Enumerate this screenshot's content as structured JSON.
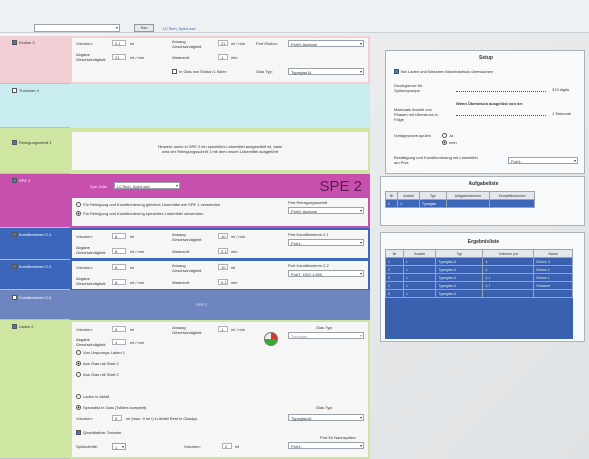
{
  "toolbar": {
    "method_select": "",
    "save_label": "Sav",
    "file_name": "LCTech_Spe4.xsd"
  },
  "left": {
    "elution": "Elution 3",
    "trocknen": "Trocknen 4",
    "reinigung": "Reinigungsventil 1",
    "spe": "SPE 2",
    "kond21": "Konditionieren 2.1",
    "kond22": "Konditionieren 2.2",
    "kond23": "Konditionieren 2.3",
    "laden": "Laden 2"
  },
  "elution_block": {
    "volumen_label": "Volumen:",
    "volumen_value": "0.1",
    "volumen_unit": "ml",
    "ansaug_label": "Ansaug Geschwindigkeit:",
    "ansaug_value": "21",
    "ansaug_unit": "ml / min",
    "port_label": "Port Elution:",
    "port_value": "Port9: Acetone",
    "abgabe_label": "Abgabe Geschwindigkeit:",
    "abgabe_value": "21",
    "abgabe_unit": "ml / min",
    "wartezeit_label": "Wartezeit:",
    "wartezeit_value": "1",
    "wartezeit_unit": "min",
    "glas_check": "In Glas von Elution 1 füllen",
    "glas_typ_label": "Glas Typ:",
    "glas_typ_value": "Typeglas14"
  },
  "reinigung_block": {
    "hint_line1": "Hinweis: wenn in SPE 2 ein spezielles Lösemittel ausgewählt ist, dann",
    "hint_line2": "wird der Reinigungsschritt 1 mit dem neuen Lösemittel ausgeführt"
  },
  "spe_block": {
    "spe_file_label": "Spe-Zelle",
    "spe_file_value": "LCTech_Spe4.xsd",
    "title": "SPE 2",
    "radio1": "Für Reinigung und Konditionierung gleiches Lösemittel wie SPE 1 verwenden",
    "radio2": "Für Reinigung und Konditionierung spezielles Lösemittel verwenden",
    "port_reinigung_label": "Port Reinigungsschritt",
    "port_reinigung_value": "Port9: Acetone"
  },
  "kond21_block": {
    "volumen_label": "Volumen:",
    "volumen_value": "8",
    "volumen_unit": "ml",
    "ansaug_label": "Ansaug Geschwindigkeit:",
    "ansaug_value": "10",
    "ansaug_unit": "ml / min",
    "port_label": "Port Konditionieren 2.1",
    "port_value": "Port1:",
    "abgabe_label": "Abgabe Geschwindigkeit:",
    "abgabe_value": "8",
    "abgabe_unit": "ml / min",
    "wartezeit_label": "Wartezeit:",
    "wartezeit_value": "0.1",
    "wartezeit_unit": "min"
  },
  "kond22_block": {
    "volumen_label": "Volumen:",
    "volumen_value": "8",
    "volumen_unit": "ml",
    "ansaug_label": "Ansaug Geschwindigkeit:",
    "ansaug_value": "10",
    "ansaug_unit": "ml",
    "port_label": "Port Konditionieren 2.2",
    "port_value": "Port7: H2O 1:500",
    "abgabe_label": "Abgabe Geschwindigkeit:",
    "abgabe_value": "8",
    "abgabe_unit": "ml / min",
    "wartezeit_label": "Wartezeit:",
    "wartezeit_value": "0.1",
    "wartezeit_unit": "min"
  },
  "kond23_block": {
    "center_label": "SPE 2"
  },
  "laden_block": {
    "volumen_label": "Volumen:",
    "volumen_value": "5",
    "volumen_unit": "ml",
    "ansaug_label": "Ansaug Geschwindigkeit:",
    "ansaug_value": "1",
    "ansaug_unit": "ml / min",
    "glas_typ_label": "Glas Typ:",
    "glas_typ_value": "Typeglas",
    "abgabe_label": "Abgabe Geschwindigkeit:",
    "abgabe_value": "1",
    "abgabe_unit": "ml / min",
    "opt1": "Von Ursprungs Laden 1",
    "opt2": "Aus Glas mit Start 2",
    "opt3": "Aus Glas mit Start 2",
    "laden_abfall": "Laden in Abfall",
    "spuelen_check": "Spezialist in Glas (Tolldes komplett)",
    "glas_typ2_label": "Glas Typ:",
    "vol_label": "Volumen:",
    "vol_value": "5",
    "vol_rest": "ml (max. 9 ml !)   in Abfall   Rest in Glastyp:",
    "glas_typ2_value": "Typeglas16",
    "quant_check": "Quantitativer Transfer",
    "spuel_label": "Spülschritte:",
    "spuel_value": "1",
    "vol2_label": "Volumen:",
    "vol2_value": "2",
    "vol2_unit": "ml",
    "port_nach_label": "Port für Nachspülen:",
    "port_nach_value": "Port1:"
  },
  "setup": {
    "title": "Setup",
    "check1": "Bei Laden und Waschen Maximaldruck überwachen",
    "druck_label": "Druckgrenze für Spülumpumpe",
    "druck_value": "319 digits",
    "anzahl_label": "Maximale Anzahl von Phasen mit Überdruck in Folge",
    "anzahl_hint": "Wenn Überdruck ausgelöst von de:",
    "anzahl_value": "1 Sekunde",
    "vorlage_label": "Vorlageprobe-spülen",
    "vorlage_opt1": "Ja",
    "vorlage_opt2": "nein",
    "bestaetigung_label": "Bestätigung und Konditionierung mit Lösemittel am Port:",
    "bestaetigung_value": "Port1:"
  },
  "aufgaben": {
    "title": "Aufgabeliste",
    "columns": [
      "Nr",
      "Anzahl",
      "Typ",
      "Aufgabevolumen",
      "Komplettvolumen"
    ],
    "rows": [
      [
        "1",
        "1",
        "Typeglas",
        "",
        ""
      ]
    ]
  },
  "ergebnisse": {
    "title": "Ergebnisliste",
    "columns": [
      "Nr",
      "Anzahl",
      "Typ",
      "Volumen pro",
      "Name"
    ],
    "rows": [
      [
        "1",
        "1",
        "Typeglas14",
        "4",
        "Elution 3"
      ],
      [
        "2",
        "1",
        "Typeglas14",
        "4",
        "Elution 2"
      ],
      [
        "3",
        "1",
        "Typeglas14",
        "4.1",
        "Elution 1"
      ],
      [
        "4",
        "1",
        "Typeglas14",
        "0.7",
        "Restwert"
      ],
      [
        "5",
        "1",
        "Typeglas14",
        "",
        ""
      ]
    ]
  },
  "colors": {
    "pink": "#f1cfd4",
    "cyan": "#c8ecef",
    "green": "#cfe6a2",
    "magenta": "#c74fae",
    "blue": "#3b66bb",
    "slate": "#6f85c0"
  }
}
